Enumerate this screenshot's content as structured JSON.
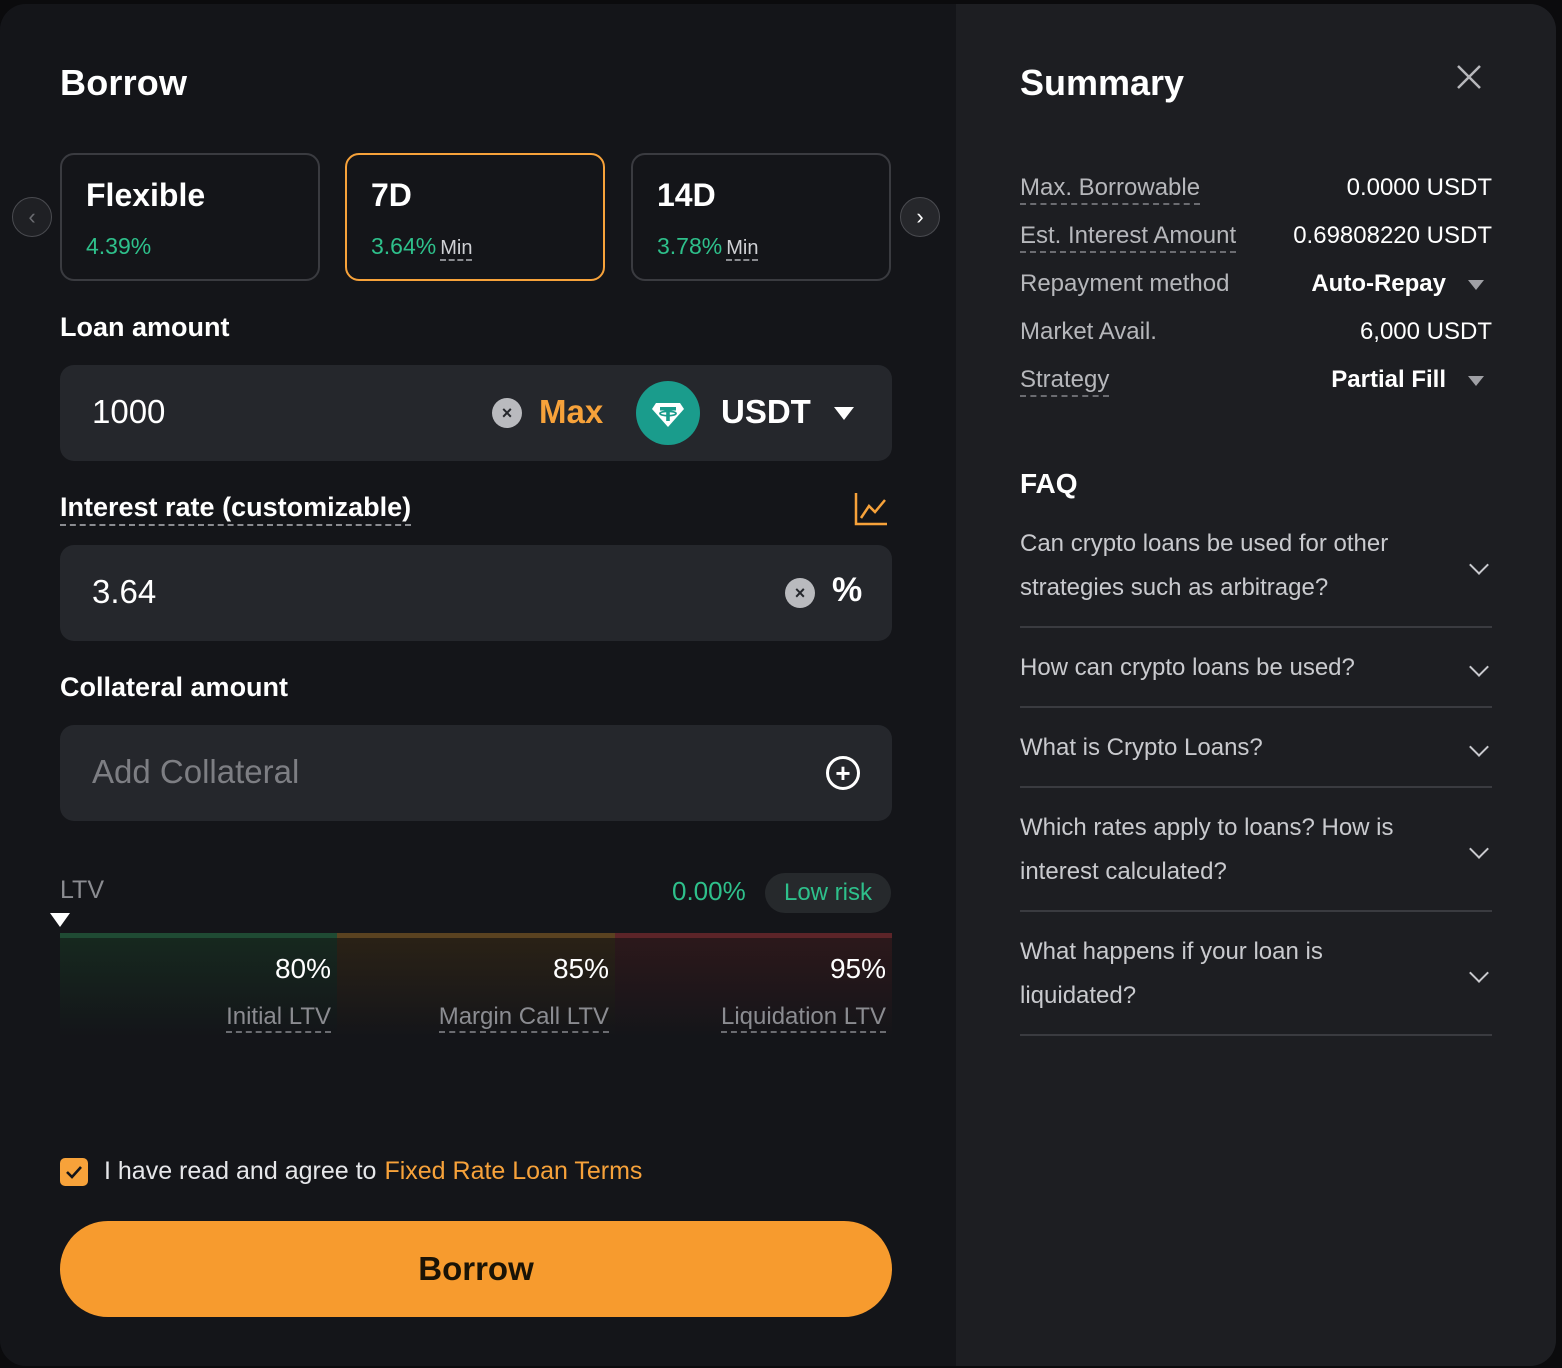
{
  "borrow": {
    "title": "Borrow",
    "terms": [
      {
        "name": "Flexible",
        "rate": "4.39%",
        "suffix": ""
      },
      {
        "name": "7D",
        "rate": "3.64%",
        "suffix": "Min"
      },
      {
        "name": "14D",
        "rate": "3.78%",
        "suffix": "Min"
      }
    ],
    "loan_amount_label": "Loan amount",
    "loan_amount_value": "1000",
    "max_label": "Max",
    "coin": "USDT",
    "interest_label": "Interest rate (customizable)",
    "interest_value": "3.64",
    "interest_unit": "%",
    "collateral_label": "Collateral amount",
    "collateral_placeholder": "Add Collateral",
    "ltv": {
      "label": "LTV",
      "value": "0.00%",
      "risk": "Low risk",
      "current_fraction": 0.0,
      "segments": [
        {
          "value": "80%",
          "label": "Initial LTV"
        },
        {
          "value": "85%",
          "label": "Margin Call LTV"
        },
        {
          "value": "95%",
          "label": "Liquidation LTV"
        }
      ]
    },
    "agree_text": "I have read and agree to",
    "agree_link": "Fixed Rate Loan Terms",
    "agree_checked": true,
    "submit_label": "Borrow"
  },
  "summary": {
    "title": "Summary",
    "rows": [
      {
        "label": "Max. Borrowable",
        "value": "0.0000 USDT"
      },
      {
        "label": "Est. Interest Amount",
        "value": "0.69808220 USDT"
      },
      {
        "label": "Repayment method",
        "value": "Auto-Repay"
      },
      {
        "label": "Market Avail.",
        "value": "6,000 USDT"
      },
      {
        "label": "Strategy",
        "value": "Partial Fill"
      }
    ]
  },
  "faq": {
    "title": "FAQ",
    "items": [
      {
        "question": "Can crypto loans be used for other strategies such as arbitrage?"
      },
      {
        "question": "How can crypto loans be used?"
      },
      {
        "question": "What is Crypto Loans?"
      },
      {
        "question": "Which rates apply to loans? How is interest calculated?"
      },
      {
        "question": "What happens if your loan is liquidated?"
      }
    ]
  },
  "colors": {
    "accent": "#f7a23a",
    "positive": "#2ec08b",
    "coin": "#1a9c8c"
  }
}
